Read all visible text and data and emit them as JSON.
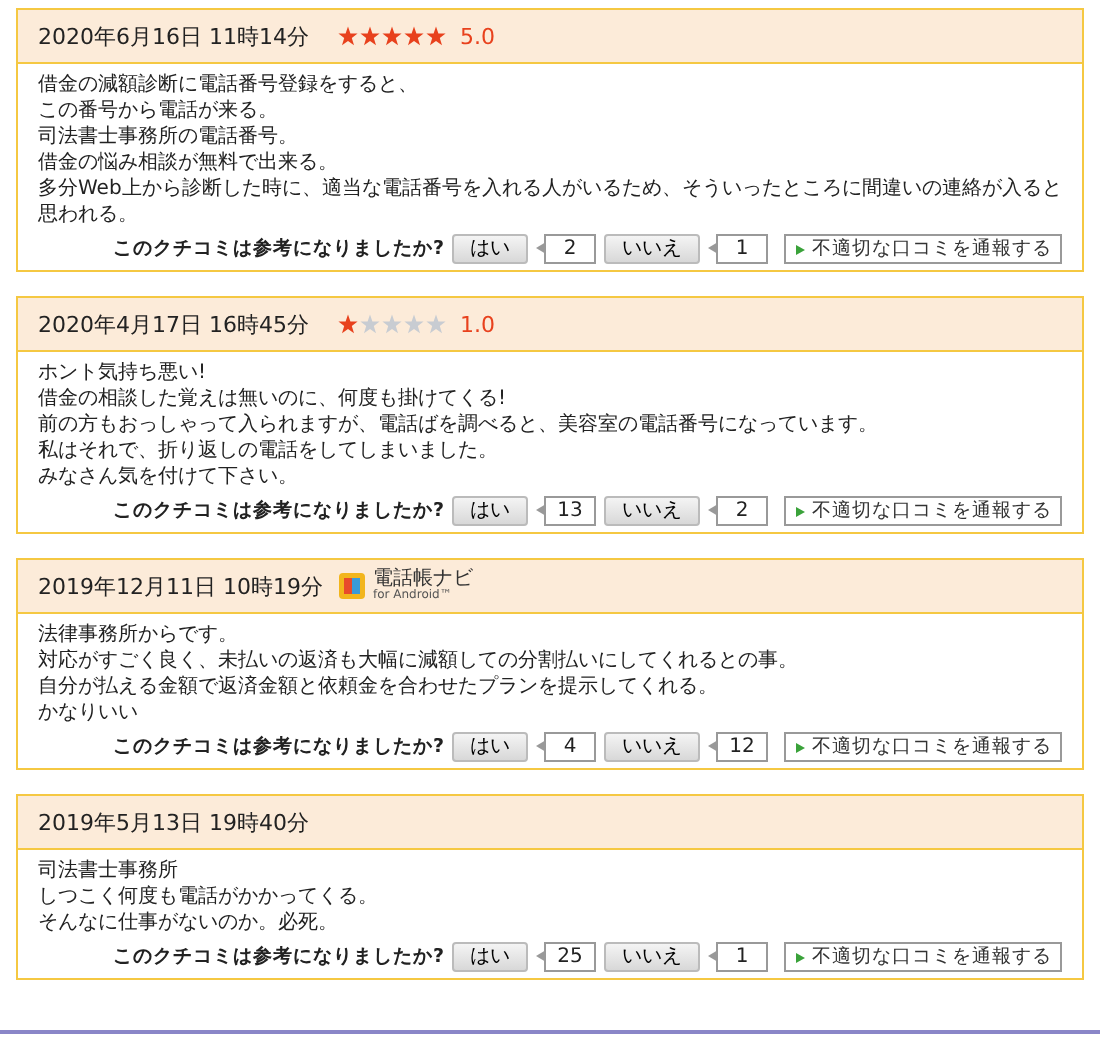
{
  "reviews": [
    {
      "date": "2020年6月16日 11時14分",
      "stars": 5,
      "score": "5.0",
      "body": [
        "借金の減額診断に電話番号登録をすると、",
        "この番号から電話が来る。",
        "司法書士事務所の電話番号。",
        "借金の悩み相談が無料で出来る。",
        "多分Web上から診断した時に、適当な電話番号を入れる人がいるため、そういったところに間違いの連絡が入ると思われる。"
      ],
      "question": "このクチコミは参考になりましたか?",
      "yes": "はい",
      "yes_count": "2",
      "no": "いいえ",
      "no_count": "1",
      "report": "不適切な口コミを通報する"
    },
    {
      "date": "2020年4月17日 16時45分",
      "stars": 1,
      "score": "1.0",
      "body": [
        "ホント気持ち悪い!",
        "借金の相談した覚えは無いのに、何度も掛けてくる!",
        "前の方もおっしゃって入られますが、電話ばを調べると、美容室の電話番号になっています。",
        "私はそれで、折り返しの電話をしてしまいました。",
        "みなさん気を付けて下さい。"
      ],
      "question": "このクチコミは参考になりましたか?",
      "yes": "はい",
      "yes_count": "13",
      "no": "いいえ",
      "no_count": "2",
      "report": "不適切な口コミを通報する"
    },
    {
      "date": "2019年12月11日 10時19分",
      "app_badge": {
        "name": "電話帳ナビ",
        "platform": "for Android™"
      },
      "body": [
        "法律事務所からです。",
        "対応がすごく良く、未払いの返済も大幅に減額しての分割払いにしてくれるとの事。",
        "自分が払える金額で返済金額と依頼金を合わせたプランを提示してくれる。",
        "かなりいい"
      ],
      "question": "このクチコミは参考になりましたか?",
      "yes": "はい",
      "yes_count": "4",
      "no": "いいえ",
      "no_count": "12",
      "report": "不適切な口コミを通報する"
    },
    {
      "date": "2019年5月13日 19時40分",
      "body": [
        "司法書士事務所",
        "しつこく何度も電話がかかってくる。",
        "そんなに仕事がないのか。必死。"
      ],
      "question": "このクチコミは参考になりましたか?",
      "yes": "はい",
      "yes_count": "25",
      "no": "いいえ",
      "no_count": "1",
      "report": "不適切な口コミを通報する"
    }
  ]
}
